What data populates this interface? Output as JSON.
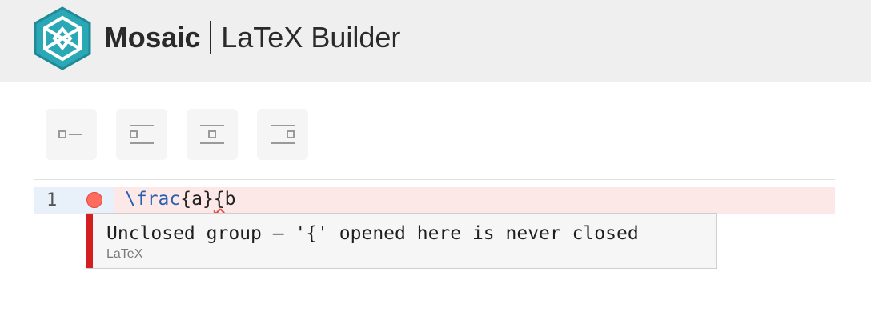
{
  "header": {
    "brand_name": "Mosaic",
    "product_name": "LaTeX Builder",
    "logo_icon": "mosaic-hexagon-logo-icon",
    "logo_color": "#2aa8b6"
  },
  "toolbar": {
    "buttons": [
      {
        "name": "align-left-button",
        "icon": "align-left-icon"
      },
      {
        "name": "align-center-button",
        "icon": "align-center-icon"
      },
      {
        "name": "align-middle-button",
        "icon": "align-middle-icon"
      },
      {
        "name": "align-right-button",
        "icon": "align-right-icon"
      }
    ]
  },
  "editor": {
    "lines": [
      {
        "number": "1",
        "has_error": true,
        "code_cmd": "\\frac",
        "code_a": "{a}",
        "code_brace": "{",
        "code_rest": "b"
      }
    ],
    "diagnostic": {
      "message": "Unclosed group — '{' opened here is never closed",
      "source": "LaTeX",
      "severity_color": "#d31f1f"
    }
  }
}
